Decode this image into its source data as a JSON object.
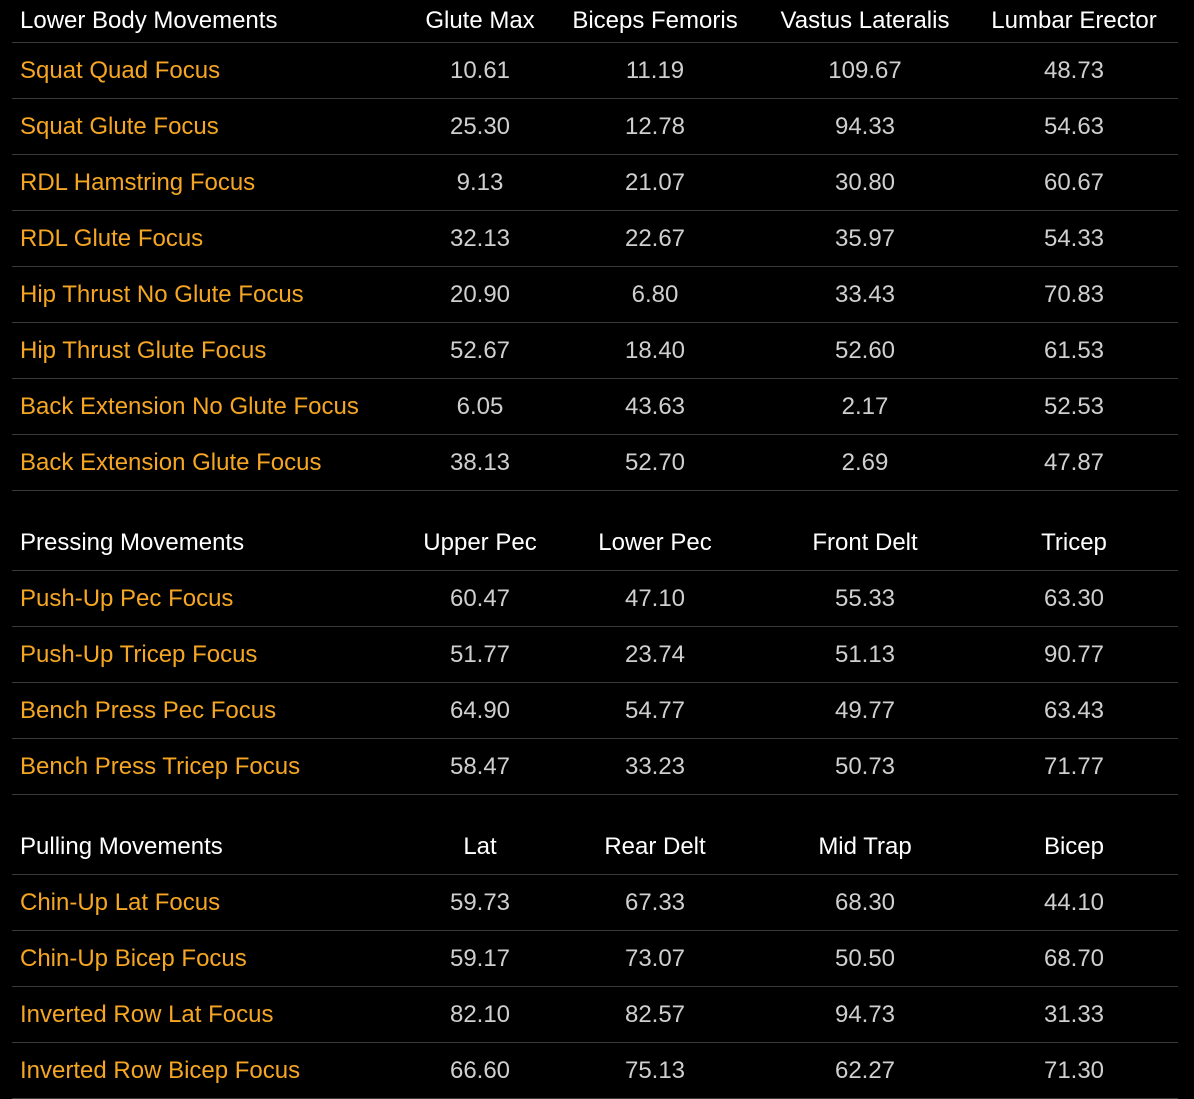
{
  "sections": [
    {
      "title": "Lower Body Movements",
      "columns": [
        "Glute Max",
        "Biceps Femoris",
        "Vastus Lateralis",
        "Lumbar Erector"
      ],
      "rows": [
        {
          "name": "Squat Quad Focus",
          "values": [
            "10.61",
            "11.19",
            "109.67",
            "48.73"
          ]
        },
        {
          "name": "Squat Glute Focus",
          "values": [
            "25.30",
            "12.78",
            "94.33",
            "54.63"
          ]
        },
        {
          "name": "RDL Hamstring Focus",
          "values": [
            "9.13",
            "21.07",
            "30.80",
            "60.67"
          ]
        },
        {
          "name": "RDL Glute Focus",
          "values": [
            "32.13",
            "22.67",
            "35.97",
            "54.33"
          ]
        },
        {
          "name": "Hip Thrust No Glute Focus",
          "values": [
            "20.90",
            "6.80",
            "33.43",
            "70.83"
          ]
        },
        {
          "name": "Hip Thrust Glute Focus",
          "values": [
            "52.67",
            "18.40",
            "52.60",
            "61.53"
          ]
        },
        {
          "name": "Back Extension No Glute Focus",
          "values": [
            "6.05",
            "43.63",
            "2.17",
            "52.53"
          ]
        },
        {
          "name": "Back Extension Glute Focus",
          "values": [
            "38.13",
            "52.70",
            "2.69",
            "47.87"
          ]
        }
      ]
    },
    {
      "title": "Pressing Movements",
      "columns": [
        "Upper Pec",
        "Lower Pec",
        "Front Delt",
        "Tricep"
      ],
      "rows": [
        {
          "name": "Push-Up Pec Focus",
          "values": [
            "60.47",
            "47.10",
            "55.33",
            "63.30"
          ]
        },
        {
          "name": "Push-Up Tricep Focus",
          "values": [
            "51.77",
            "23.74",
            "51.13",
            "90.77"
          ]
        },
        {
          "name": "Bench Press Pec Focus",
          "values": [
            "64.90",
            "54.77",
            "49.77",
            "63.43"
          ]
        },
        {
          "name": "Bench Press Tricep Focus",
          "values": [
            "58.47",
            "33.23",
            "50.73",
            "71.77"
          ]
        }
      ]
    },
    {
      "title": "Pulling Movements",
      "columns": [
        "Lat",
        "Rear Delt",
        "Mid Trap",
        "Bicep"
      ],
      "rows": [
        {
          "name": "Chin-Up Lat Focus",
          "values": [
            "59.73",
            "67.33",
            "68.30",
            "44.10"
          ]
        },
        {
          "name": "Chin-Up Bicep Focus",
          "values": [
            "59.17",
            "73.07",
            "50.50",
            "68.70"
          ]
        },
        {
          "name": "Inverted Row Lat Focus",
          "values": [
            "82.10",
            "82.57",
            "94.73",
            "31.33"
          ]
        },
        {
          "name": "Inverted Row Bicep Focus",
          "values": [
            "66.60",
            "75.13",
            "62.27",
            "71.30"
          ]
        }
      ]
    }
  ],
  "colors": {
    "background": "#000000",
    "movement_text": "#f5a623",
    "header_text": "#ffffff",
    "value_text": "#cfcfcf",
    "divider": "#3a3a3a"
  }
}
